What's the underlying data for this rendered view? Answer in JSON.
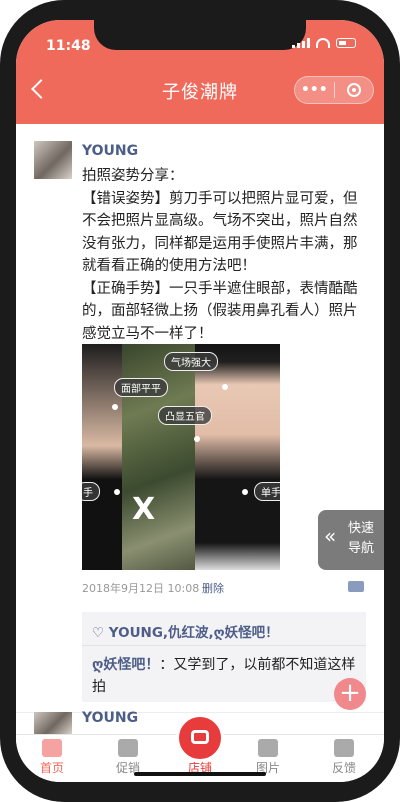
{
  "status": {
    "time": "11:48"
  },
  "header": {
    "title": "子俊潮牌",
    "more": "•••"
  },
  "post": {
    "username": "YOUNG",
    "text": [
      "拍照姿势分享：",
      "【错误姿势】剪刀手可以把照片显可爱，但不会把照片显高级。气场不突出，照片自然没有张力，同样都是运用手使照片丰满，那就看看正确的使用方法吧！",
      "【正确手势】一只手半遮住眼部，表情酷酷的，面部轻微上扬（假装用鼻孔看人）照片感觉立马不一样了！"
    ],
    "photo_tags": {
      "aura": "气场强大",
      "face": "面部平平",
      "features": "凸显五官",
      "left_hand": "手",
      "right_hand": "单手"
    },
    "photo_mark": "X",
    "date": "2018年9月12日 10:08",
    "delete": "删除",
    "likes": "♡ YOUNG,仇红波,ღ妖怪吧！",
    "comment": {
      "name": "ღ妖怪吧！",
      "text": "：又学到了，以前都不知道这样拍"
    }
  },
  "next_post": {
    "username": "YOUNG"
  },
  "quick_nav": {
    "arrow": "«",
    "label": "快速导航"
  },
  "fab": "+",
  "tabs": [
    {
      "label": "首页",
      "active": true
    },
    {
      "label": "促销",
      "active": false
    },
    {
      "label": "店铺",
      "active": false
    },
    {
      "label": "图片",
      "active": false
    },
    {
      "label": "反馈",
      "active": false
    }
  ],
  "colors": {
    "accent": "#f06a5c",
    "link": "#4c5d88",
    "center_tab": "#e83c3c"
  }
}
